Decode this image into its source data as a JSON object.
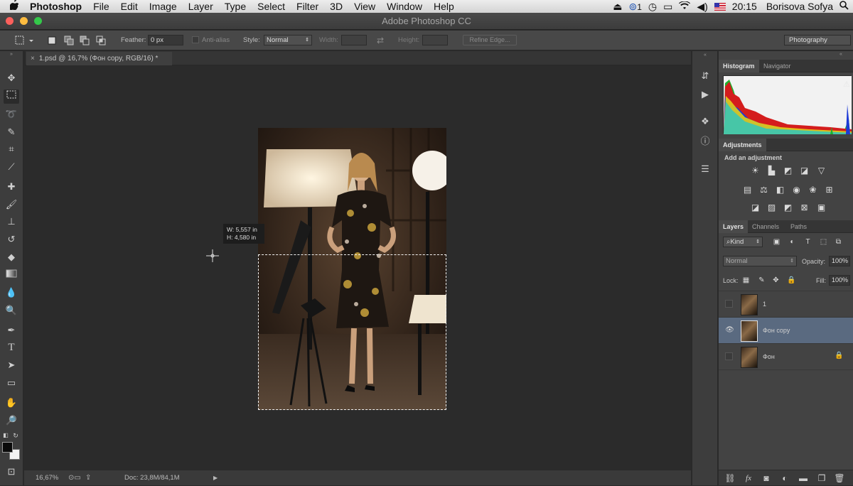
{
  "menubar": {
    "apple": "",
    "items": [
      "Photoshop",
      "File",
      "Edit",
      "Image",
      "Layer",
      "Type",
      "Select",
      "Filter",
      "3D",
      "View",
      "Window",
      "Help"
    ],
    "status_count": "1",
    "clock": "20:15",
    "user": "Borisova Sofya"
  },
  "window": {
    "title": "Adobe Photoshop CC"
  },
  "options": {
    "feather_label": "Feather:",
    "feather_value": "0 px",
    "antialias_label": "Anti-alias",
    "style_label": "Style:",
    "style_value": "Normal",
    "width_label": "Width:",
    "height_label": "Height:",
    "refine_edge": "Refine Edge...",
    "workspace": "Photography"
  },
  "document": {
    "tab_title": "1.psd @ 16,7% (Фон copy, RGB/16) *",
    "measure_w": "W: 5,557 in",
    "measure_h": "H: 4,580 in",
    "zoom": "16,67%",
    "doc_size": "Doc: 23,8M/84,1M"
  },
  "panels": {
    "histogram_tab": "Histogram",
    "navigator_tab": "Navigator",
    "adjustments_tab": "Adjustments",
    "add_adjustment": "Add an adjustment",
    "layers_tab": "Layers",
    "channels_tab": "Channels",
    "paths_tab": "Paths",
    "kind_filter": "Kind",
    "blend_mode": "Normal",
    "opacity_label": "Opacity:",
    "opacity_value": "100%",
    "lock_label": "Lock:",
    "fill_label": "Fill:",
    "fill_value": "100%",
    "layers": [
      {
        "name": "1",
        "visible": false,
        "selected": false,
        "locked": false
      },
      {
        "name": "Фон copy",
        "visible": true,
        "selected": true,
        "locked": false
      },
      {
        "name": "Фон",
        "visible": false,
        "selected": false,
        "locked": true
      }
    ]
  },
  "colors": {
    "selected_layer": "#5a6a80",
    "panel_bg": "#434343",
    "canvas_bg": "#2b2b2b"
  }
}
